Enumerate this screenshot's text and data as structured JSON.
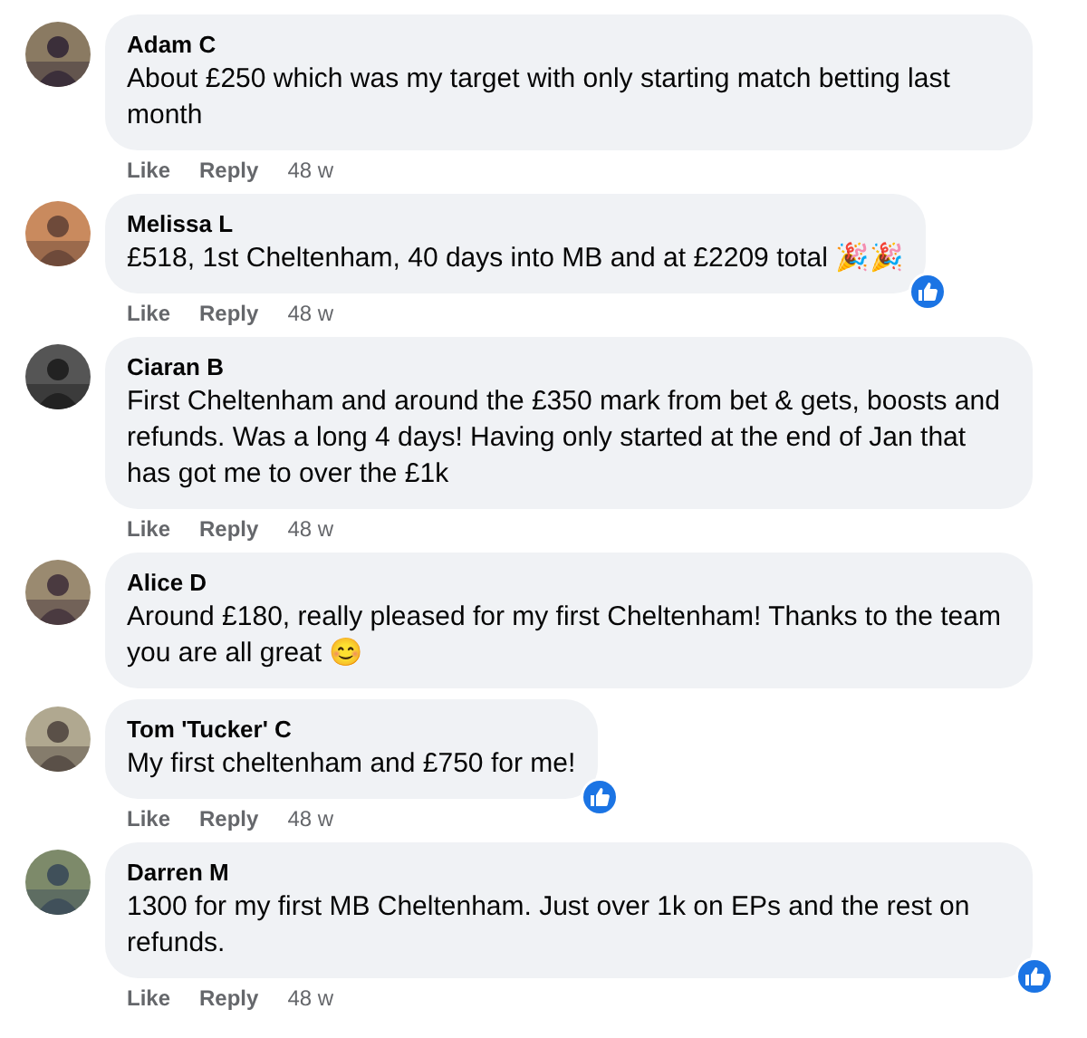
{
  "comments": [
    {
      "author": "Adam C",
      "text": "About £250 which was my target with only starting match betting last month",
      "actions": [
        "Like",
        "Reply"
      ],
      "time": "48 w",
      "liked": false
    },
    {
      "author": "Melissa L",
      "text": "£518, 1st Cheltenham, 40 days into MB and at £2209 total 🎉🎉",
      "actions": [
        "Like",
        "Reply"
      ],
      "time": "48 w",
      "liked": true
    },
    {
      "author": "Ciaran B",
      "text": "First Cheltenham and around the £350 mark from bet & gets, boosts and refunds. Was a long 4 days! Having only started at the end of Jan that has got me to over the £1k",
      "actions": [
        "Like",
        "Reply"
      ],
      "time": "48 w",
      "liked": false
    },
    {
      "author": "Alice D",
      "text": "Around £180, really pleased for my first Cheltenham! Thanks to the team you are all great 😊",
      "liked": false
    },
    {
      "author": "Tom 'Tucker' C",
      "text": "My first cheltenham and £750 for me!",
      "actions": [
        "Like",
        "Reply"
      ],
      "time": "48 w",
      "liked": true
    },
    {
      "author": "Darren M",
      "text": "1300 for my first MB Cheltenham. Just over 1k on EPs and the rest on refunds.",
      "actions": [
        "Like",
        "Reply"
      ],
      "time": "48 w",
      "liked": true
    }
  ]
}
